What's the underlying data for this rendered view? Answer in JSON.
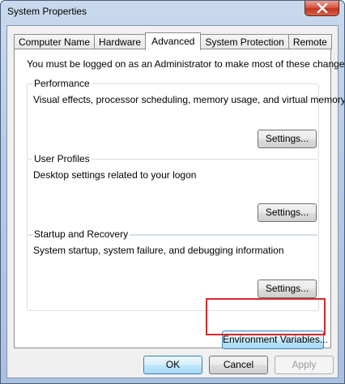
{
  "window": {
    "title": "System Properties",
    "close_icon": "close-icon"
  },
  "tabs": [
    {
      "label": "Computer Name",
      "active": false
    },
    {
      "label": "Hardware",
      "active": false
    },
    {
      "label": "Advanced",
      "active": true
    },
    {
      "label": "System Protection",
      "active": false
    },
    {
      "label": "Remote",
      "active": false
    }
  ],
  "advanced": {
    "note": "You must be logged on as an Administrator to make most of these changes.",
    "performance": {
      "title": "Performance",
      "description": "Visual effects, processor scheduling, memory usage, and virtual memory",
      "button": "Settings..."
    },
    "user_profiles": {
      "title": "User Profiles",
      "description": "Desktop settings related to your logon",
      "button": "Settings..."
    },
    "startup_recovery": {
      "title": "Startup and Recovery",
      "description": "System startup, system failure, and debugging information",
      "button": "Settings..."
    },
    "environment_button": "Environment Variables..."
  },
  "dialog_buttons": {
    "ok": "OK",
    "cancel": "Cancel",
    "apply": "Apply"
  },
  "colors": {
    "highlight_box": "#d42a2a",
    "close_button": "#c2351f"
  }
}
